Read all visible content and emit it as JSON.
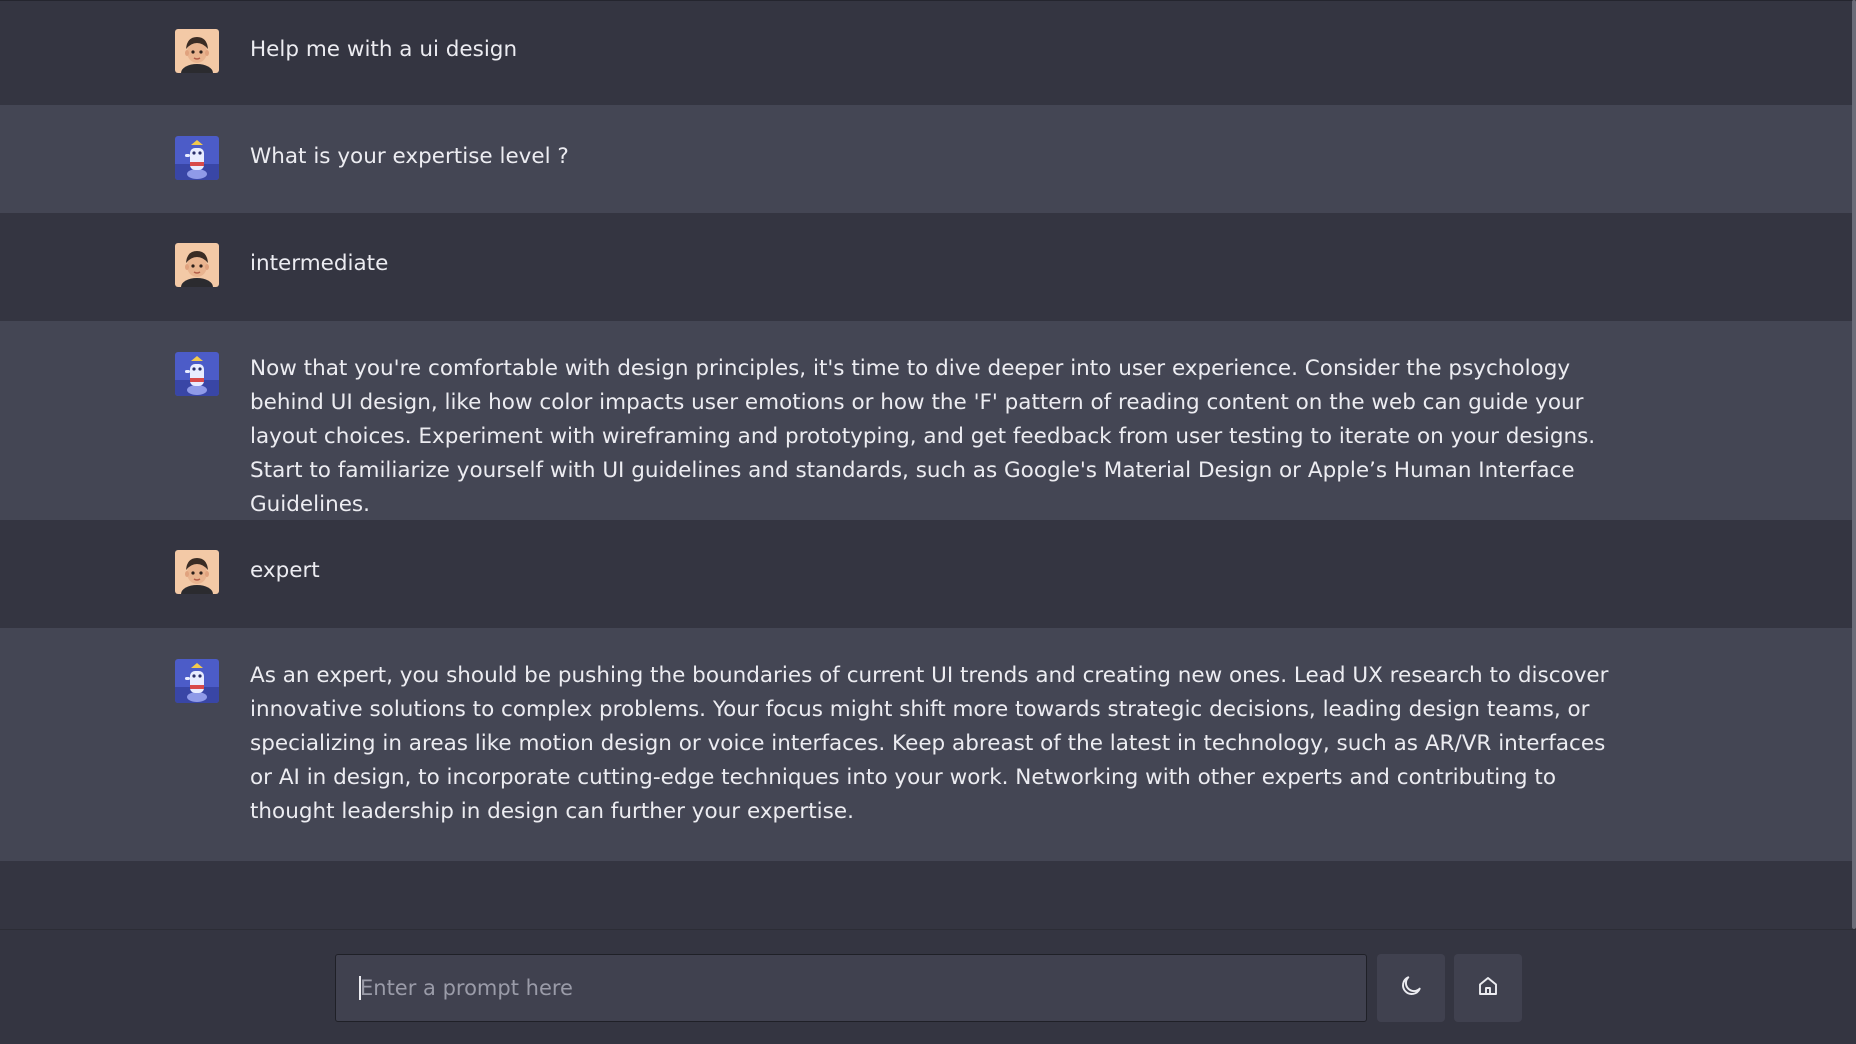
{
  "conversation": [
    {
      "role": "user",
      "avatar_icon": "user-avatar-icon",
      "text": "Help me with a ui design"
    },
    {
      "role": "bot",
      "avatar_icon": "bot-avatar-icon",
      "text": "What is your expertise level ?"
    },
    {
      "role": "user",
      "avatar_icon": "user-avatar-icon",
      "text": "intermediate"
    },
    {
      "role": "bot",
      "avatar_icon": "bot-avatar-icon",
      "text": "Now that you're comfortable with design principles, it's time to dive deeper into user experience. Consider the psychology behind UI design, like how color impacts user emotions or how the 'F' pattern of reading content on the web can guide your layout choices. Experiment with wireframing and prototyping, and get feedback from user testing to iterate on your designs. Start to familiarize yourself with UI guidelines and standards, such as Google's Material Design or Apple’s Human Interface Guidelines."
    },
    {
      "role": "user",
      "avatar_icon": "user-avatar-icon",
      "text": "expert"
    },
    {
      "role": "bot",
      "avatar_icon": "bot-avatar-icon",
      "text": "As an expert, you should be pushing the boundaries of current UI trends and creating new ones. Lead UX research to discover innovative solutions to complex problems. Your focus might shift more towards strategic decisions, leading design teams, or specializing in areas like motion design or voice interfaces. Keep abreast of the latest in technology, such as AR/VR interfaces or AI in design, to incorporate cutting-edge techniques into your work. Networking with other experts and contributing to thought leadership in design can further your expertise."
    }
  ],
  "prompt": {
    "placeholder": "Enter a prompt here",
    "value": ""
  },
  "buttons": {
    "theme_toggle_icon": "moon-icon",
    "home_icon": "home-icon"
  },
  "colors": {
    "background": "#343541",
    "bot_row": "#444654",
    "input_bg": "#40414f",
    "text": "#ececf1"
  }
}
